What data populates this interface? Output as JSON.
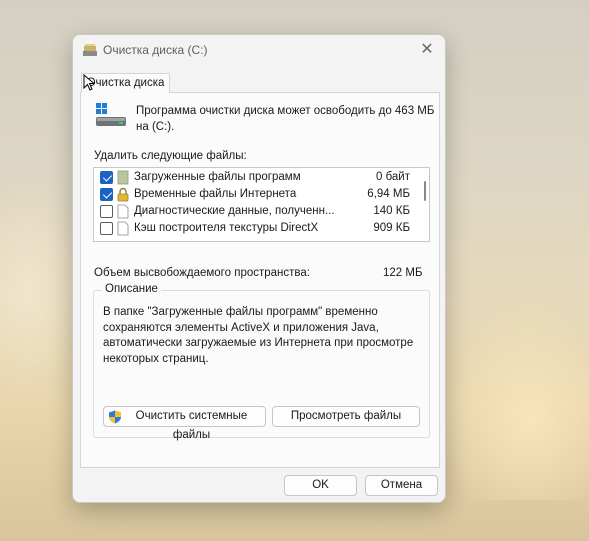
{
  "window": {
    "title": "Очистка диска  (C:)"
  },
  "tab": {
    "label": "Очистка диска"
  },
  "info": {
    "text": "Программа очистки диска может освободить до 463 МБ на  (C:)."
  },
  "files": {
    "label": "Удалить следующие файлы:",
    "items": [
      {
        "name": "Загруженные файлы программ",
        "size": "0 байт",
        "checked": true,
        "icon": "folder-icon"
      },
      {
        "name": "Временные файлы Интернета",
        "size": "6,94 МБ",
        "checked": true,
        "icon": "lock-icon"
      },
      {
        "name": "Диагностические данные, полученн...",
        "size": "140 КБ",
        "checked": false,
        "icon": "file-icon"
      },
      {
        "name": "Кэш построителя текстуры DirectX",
        "size": "909 КБ",
        "checked": false,
        "icon": "file-icon"
      }
    ]
  },
  "space": {
    "label": "Объем высвобождаемого пространства:",
    "value": "122 МБ"
  },
  "description": {
    "title": "Описание",
    "text": "В папке \"Загруженные файлы программ\" временно сохраняются элементы ActiveX и приложения Java, автоматически загружаемые из Интернета при просмотре некоторых страниц."
  },
  "buttons": {
    "clean_system": "Очистить системные файлы",
    "view_files": "Просмотреть файлы",
    "ok": "OK",
    "cancel": "Отмена"
  },
  "colors": {
    "accent": "#1b62c4"
  }
}
